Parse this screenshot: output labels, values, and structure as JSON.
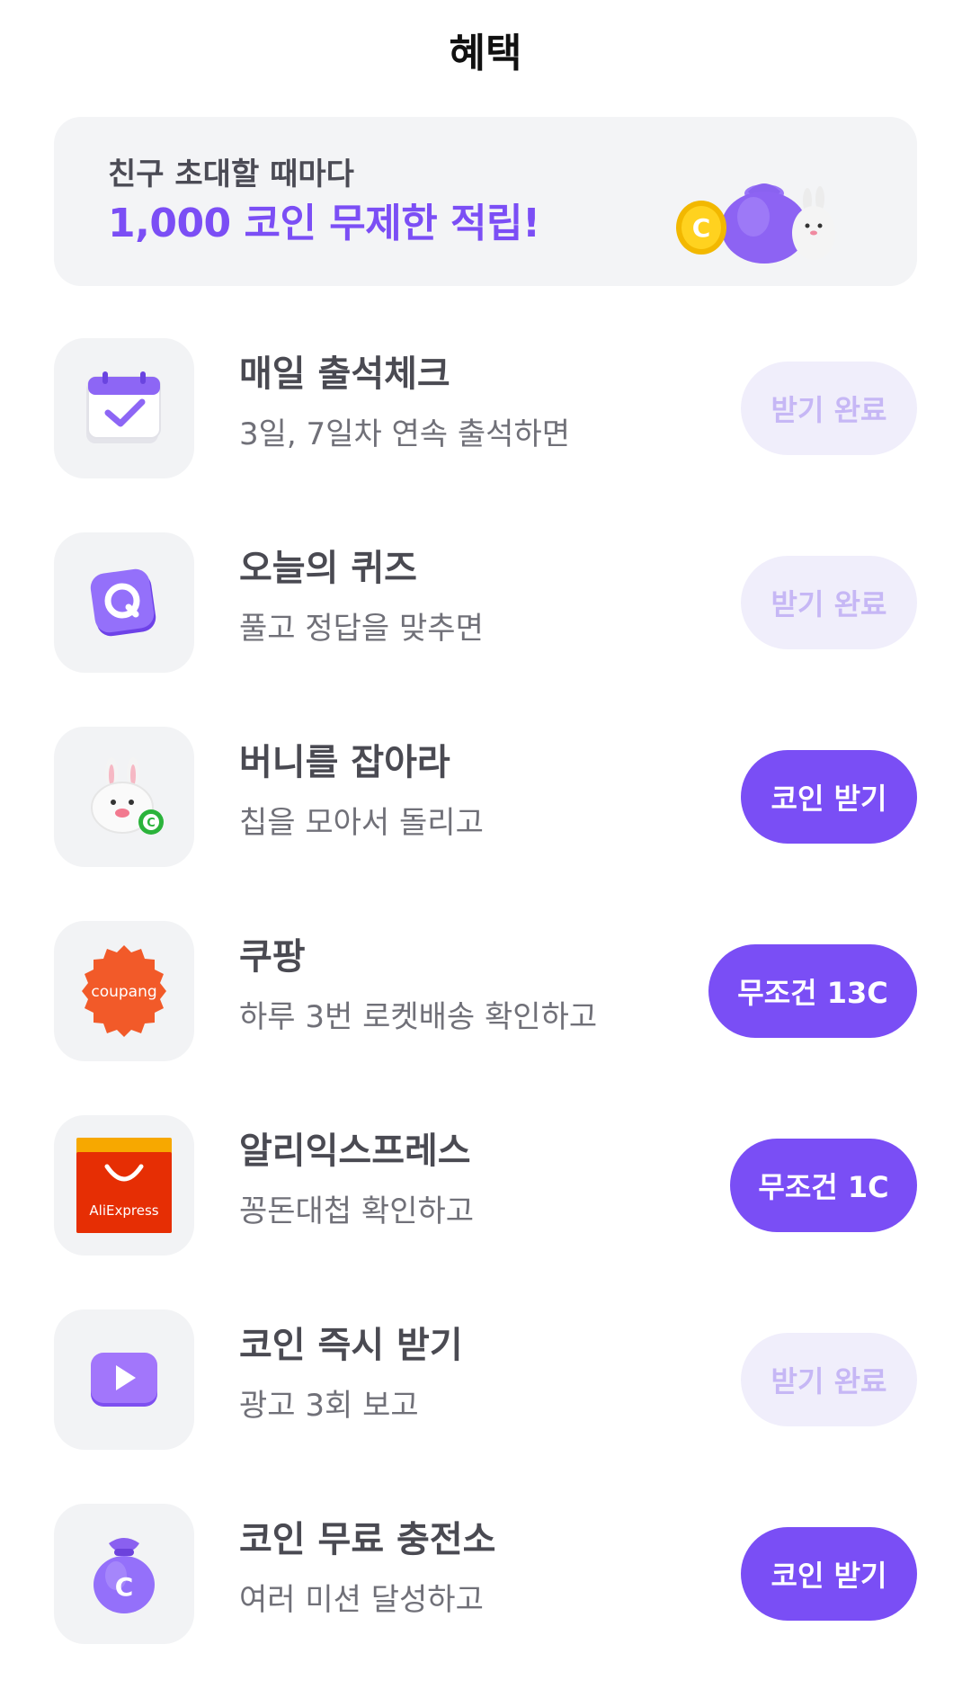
{
  "header": {
    "title": "혜택"
  },
  "banner": {
    "line1": "친구 초대할 때마다",
    "line2": "1,000 코인 무제한 적립!",
    "accent_color": "#7b4ef5"
  },
  "items": [
    {
      "icon": "calendar-check-icon",
      "title": "매일 출석체크",
      "subtitle": "3일, 7일차 연속 출석하면",
      "button": "받기 완료",
      "state": "done"
    },
    {
      "icon": "quiz-q-icon",
      "title": "오늘의 퀴즈",
      "subtitle": "풀고 정답을 맞추면",
      "button": "받기 완료",
      "state": "done"
    },
    {
      "icon": "bunny-coin-icon",
      "title": "버니를 잡아라",
      "subtitle": "칩을 모아서 돌리고",
      "button": "코인 받기",
      "state": "active"
    },
    {
      "icon": "coupang-logo-icon",
      "icon_text": "coupang",
      "title": "쿠팡",
      "subtitle": "하루 3번 로켓배송 확인하고",
      "button": "무조건 13C",
      "state": "active"
    },
    {
      "icon": "aliexpress-logo-icon",
      "icon_text": "AliExpress",
      "title": "알리익스프레스",
      "subtitle": "꽁돈대첩 확인하고",
      "button": "무조건 1C",
      "state": "active"
    },
    {
      "icon": "video-play-icon",
      "title": "코인 즉시 받기",
      "subtitle": "광고 3회 보고",
      "button": "받기 완료",
      "state": "done"
    },
    {
      "icon": "coin-bag-icon",
      "title": "코인 무료 충전소",
      "subtitle": "여러 미션 달성하고",
      "button": "코인 받기",
      "state": "active"
    }
  ],
  "colors": {
    "primary": "#7a4ef5",
    "done_bg": "#f0eefb",
    "done_text": "#c6b7f5",
    "coupang": "#f25a29",
    "aliexpress": "#e62e04"
  }
}
